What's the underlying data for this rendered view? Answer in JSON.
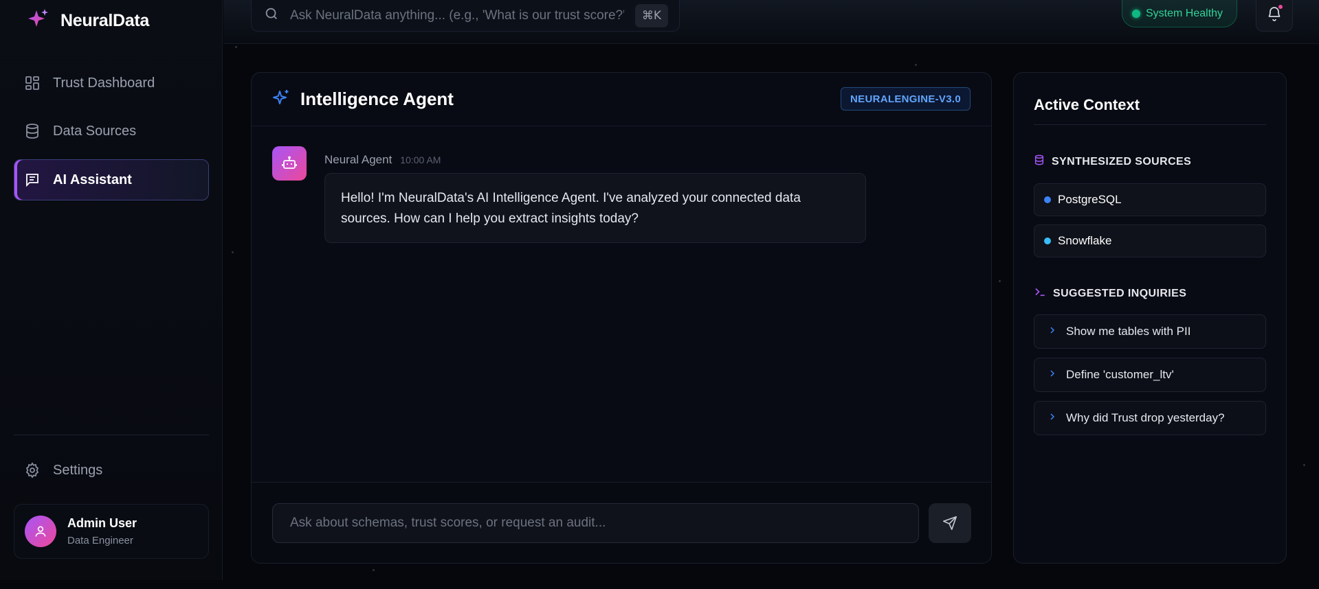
{
  "app": {
    "name": "NeuralData"
  },
  "sidebar": {
    "items": [
      {
        "label": "Trust Dashboard",
        "icon": "grid-icon"
      },
      {
        "label": "Data Sources",
        "icon": "database-icon"
      },
      {
        "label": "AI Assistant",
        "icon": "chat-icon",
        "active": true
      }
    ],
    "settings_label": "Settings",
    "user": {
      "name": "Admin User",
      "role": "Data Engineer"
    }
  },
  "topbar": {
    "search_placeholder": "Ask NeuralData anything... (e.g., 'What is our trust score?'",
    "shortcut": "⌘K",
    "status": "System Healthy"
  },
  "chat": {
    "title": "Intelligence Agent",
    "version": "NEURALENGINE-V3.0",
    "messages": [
      {
        "sender": "Neural Agent",
        "time": "10:00 AM",
        "text": "Hello! I'm NeuralData's AI Intelligence Agent. I've analyzed your connected data sources. How can I help you extract insights today?"
      }
    ],
    "input_placeholder": "Ask about schemas, trust scores, or request an audit..."
  },
  "context": {
    "title": "Active Context",
    "sources_heading": "SYNTHESIZED SOURCES",
    "sources": [
      {
        "name": "PostgreSQL",
        "color": "#3b82f6"
      },
      {
        "name": "Snowflake",
        "color": "#38bdf8"
      }
    ],
    "inquiries_heading": "SUGGESTED INQUIRIES",
    "inquiries": [
      "Show me tables with PII",
      "Define 'customer_ltv'",
      "Why did Trust drop yesterday?"
    ]
  },
  "colors": {
    "accent_purple": "#a855f7",
    "accent_pink": "#ec4899",
    "accent_blue": "#3b82f6",
    "status_green": "#10b981"
  }
}
